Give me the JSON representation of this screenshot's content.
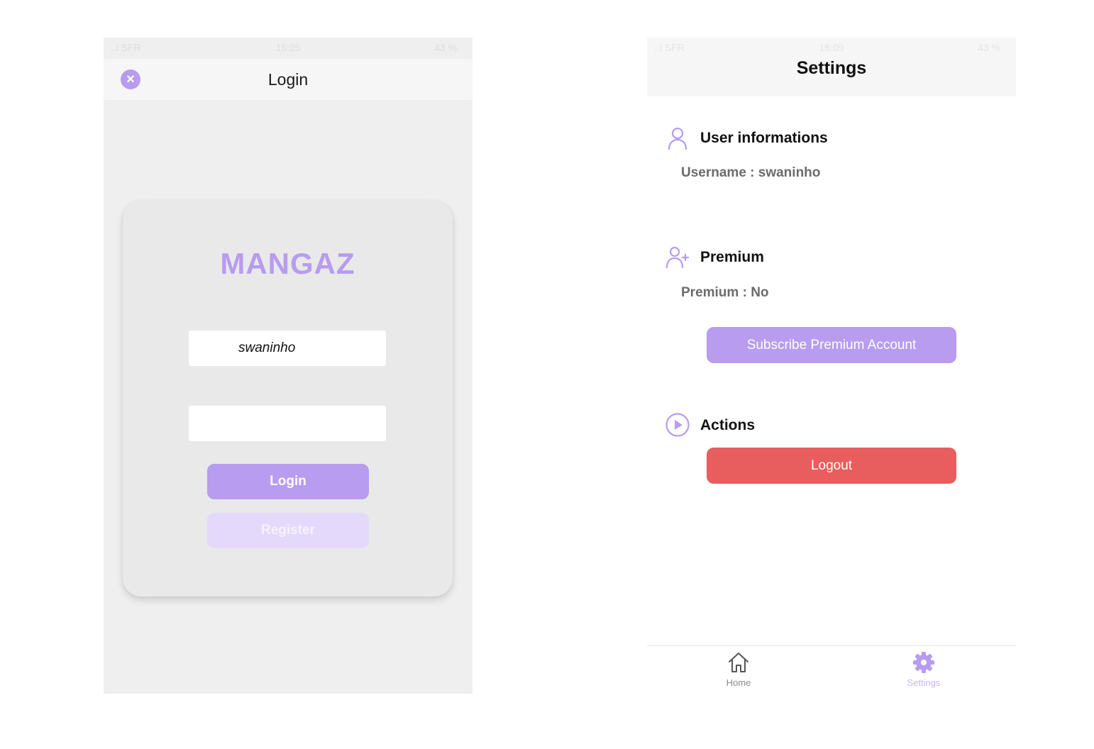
{
  "login_screen": {
    "status_bar": {
      "left": "..l SFR",
      "time": "15:25",
      "right": "43 %"
    },
    "header": {
      "title": "Login",
      "close_icon": "close-circle-icon"
    },
    "card": {
      "brand": "MANGAZ",
      "username_value": "swaninho",
      "password_value": "",
      "login_label": "Login",
      "register_label": "Register"
    }
  },
  "settings_screen": {
    "status_bar": {
      "left": "..l SFR",
      "time": "16:09",
      "right": "43 %"
    },
    "header": {
      "title": "Settings"
    },
    "user_section": {
      "icon": "user-icon",
      "title": "User informations",
      "username_line": "Username : swaninho"
    },
    "premium_section": {
      "icon": "user-plus-icon",
      "title": "Premium",
      "premium_line": "Premium : No",
      "subscribe_label": "Subscribe Premium Account"
    },
    "actions_section": {
      "icon": "play-circle-icon",
      "title": "Actions",
      "logout_label": "Logout"
    },
    "tab_bar": {
      "tabs": [
        {
          "label": "Home",
          "icon": "home-icon",
          "active": false
        },
        {
          "label": "Settings",
          "icon": "gear-icon",
          "active": true
        }
      ]
    }
  },
  "colors": {
    "accent": "#b79cf0",
    "accent_light": "#e4d9fb",
    "danger": "#e85d5d",
    "screen_background": "#efefef"
  }
}
